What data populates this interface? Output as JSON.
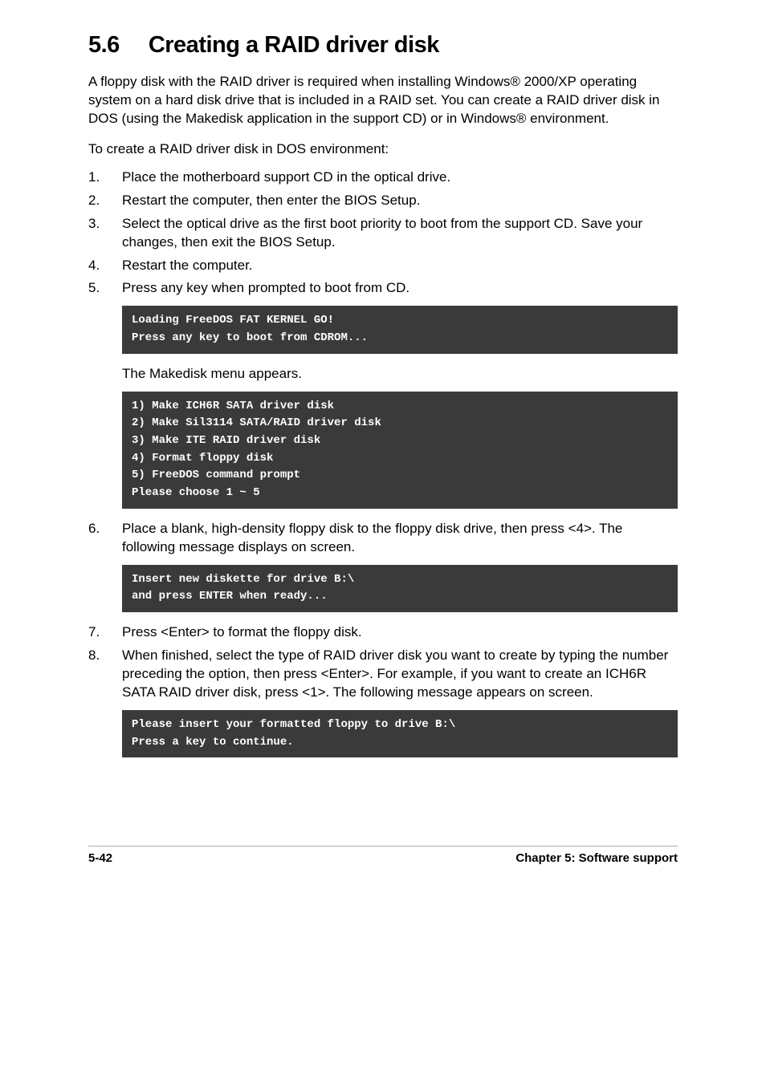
{
  "section": {
    "number": "5.6",
    "title": "Creating a RAID driver disk"
  },
  "intro": "A floppy disk with the RAID driver is required when installing Windows® 2000/XP operating system on a hard disk drive that is included in a RAID set. You can create a RAID driver disk in DOS (using the Makedisk application in the support CD) or in Windows® environment.",
  "subhead": "To create a RAID driver disk in DOS environment:",
  "steps1": [
    {
      "n": "1.",
      "t": "Place the motherboard support CD in the optical drive."
    },
    {
      "n": "2.",
      "t": "Restart the computer, then enter the BIOS Setup."
    },
    {
      "n": "3.",
      "t": "Select the optical drive as the first boot priority to boot from the support CD. Save your changes, then exit the BIOS Setup."
    },
    {
      "n": "4.",
      "t": "Restart the computer."
    },
    {
      "n": "5.",
      "t": "Press any key when prompted to boot from CD."
    }
  ],
  "terminal1": "Loading FreeDOS FAT KERNEL GO!\nPress any key to boot from CDROM...",
  "afterTerminal1": "The Makedisk menu appears.",
  "terminal2": "1) Make ICH6R SATA driver disk\n2) Make Sil3114 SATA/RAID driver disk\n3) Make ITE RAID driver disk\n4) Format floppy disk\n5) FreeDOS command prompt\nPlease choose 1 ~ 5",
  "steps2": [
    {
      "n": "6.",
      "t": "Place a blank, high-density floppy disk to the floppy disk drive, then press <4>. The following message displays on screen."
    }
  ],
  "terminal3": "Insert new diskette for drive B:\\\nand press ENTER when ready...",
  "steps3": [
    {
      "n": "7.",
      "t": "Press <Enter> to format the floppy disk."
    },
    {
      "n": "8.",
      "t": "When finished, select the type of RAID driver disk you want to create by typing the number preceding the option, then press <Enter>. For example, if you want to create an ICH6R SATA RAID driver disk, press <1>. The following message appears on screen."
    }
  ],
  "terminal4": "Please insert your formatted floppy to drive B:\\\nPress a key to continue.",
  "footer": {
    "left": "5-42",
    "right": "Chapter 5: Software support"
  }
}
